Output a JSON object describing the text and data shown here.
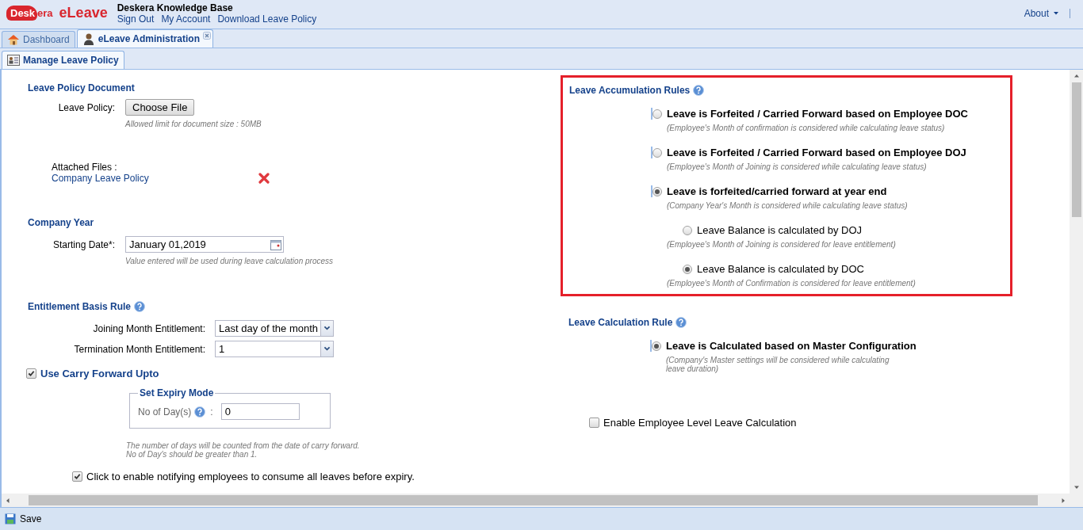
{
  "header": {
    "logo_part1": "Desk",
    "logo_part2": "era",
    "product": "eLeave",
    "title": "Deskera Knowledge Base",
    "links": [
      "Sign Out",
      "My Account",
      "Download Leave Policy"
    ],
    "about": "About"
  },
  "tabs": [
    {
      "label": "Dashboard",
      "selected": false,
      "closable": false
    },
    {
      "label": "eLeave Administration",
      "selected": true,
      "closable": true
    }
  ],
  "subtabs": [
    {
      "label": "Manage Leave Policy",
      "selected": true
    }
  ],
  "policy_document": {
    "title": "Leave Policy Document",
    "field_label": "Leave Policy:",
    "button": "Choose File",
    "hint": "Allowed limit for document size : 50MB",
    "attached_label": "Attached Files :",
    "attached_file": "Company Leave Policy"
  },
  "company_year": {
    "title": "Company Year",
    "field_label": "Starting Date*:",
    "value": "January 01,2019",
    "hint": "Value entered will be used during leave calculation process"
  },
  "entitlement": {
    "title": "Entitlement Basis Rule",
    "rows": [
      {
        "label": "Joining Month Entitlement:",
        "value": "Last day of the month"
      },
      {
        "label": "Termination Month Entitlement:",
        "value": "1"
      }
    ]
  },
  "carry_forward": {
    "label": "Use Carry Forward Upto",
    "checked": true,
    "fieldset_title": "Set Expiry Mode",
    "field_label": "No of Day(s)",
    "separator": ":",
    "value": "0",
    "hint_lines": [
      "The number of days will be counted from the date of carry forward.",
      "No of Day's should be greater than 1."
    ]
  },
  "notify": {
    "label": "Click to enable notifying employees to consume all leaves before expiry.",
    "checked": true
  },
  "accumulation": {
    "title": "Leave Accumulation Rules",
    "options": [
      {
        "kind": "main",
        "label": "Leave is Forfeited / Carried Forward based on Employee DOC",
        "description": "(Employee's Month of confirmation is considered while calculating leave status)",
        "selected": false
      },
      {
        "kind": "main",
        "label": "Leave is Forfeited / Carried Forward based on Employee DOJ",
        "description": "(Employee's Month of Joining is considered while calculating leave status)",
        "selected": false
      },
      {
        "kind": "main",
        "label": "Leave is forfeited/carried forward at year end",
        "description": "(Company Year's Month is considered while calculating leave status)",
        "selected": true
      },
      {
        "kind": "sub",
        "label": "Leave Balance is calculated by DOJ",
        "description": "(Employee's Month of Joining is considered for leave entitlement)",
        "selected": false
      },
      {
        "kind": "sub",
        "label": "Leave Balance is calculated by DOC",
        "description": "(Employee's Month of Confirmation is considered for leave entitlement)",
        "selected": true
      }
    ]
  },
  "calculation": {
    "title": "Leave Calculation Rule",
    "options": [
      {
        "kind": "main",
        "label": "Leave is Calculated based on Master Configuration",
        "description": "(Company's Master settings will be considered while calculating leave duration)",
        "selected": true
      }
    ]
  },
  "employee_level": {
    "label": "Enable Employee Level Leave Calculation",
    "checked": false
  },
  "toolbar": {
    "save": "Save"
  }
}
